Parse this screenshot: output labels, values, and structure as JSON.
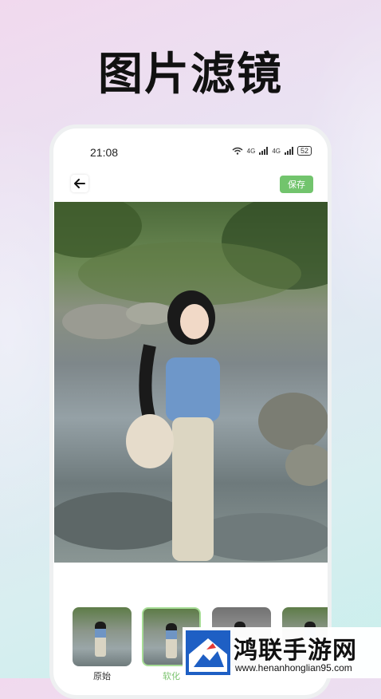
{
  "headline": "图片滤镜",
  "status_bar": {
    "time": "21:08",
    "network_1": "4G",
    "network_2": "4G",
    "battery": "52"
  },
  "topbar": {
    "back_icon": "arrow-left-icon",
    "save_label": "保存"
  },
  "photo": {
    "subject": "photo-preview"
  },
  "filters": [
    {
      "label": "原始",
      "selected": false
    },
    {
      "label": "软化",
      "selected": true
    },
    {
      "label": "",
      "selected": false
    },
    {
      "label": "",
      "selected": false
    }
  ],
  "watermark": {
    "name": "鸿联手游网",
    "url": "www.henanhonglian95.com"
  },
  "colors": {
    "accent": "#72c46d",
    "selected_label": "#7cc46f"
  }
}
